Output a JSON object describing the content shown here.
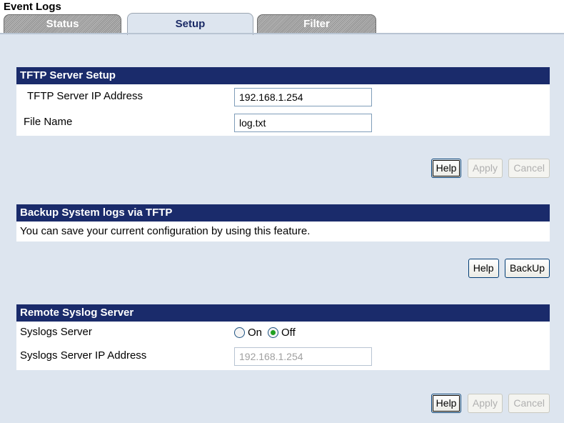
{
  "page": {
    "title": "Event Logs"
  },
  "tabs": [
    {
      "label": "Status",
      "active": false
    },
    {
      "label": "Setup",
      "active": true
    },
    {
      "label": "Filter",
      "active": false
    }
  ],
  "tftp": {
    "header": "TFTP Server Setup",
    "ip_label": "TFTP Server IP Address",
    "ip_value": "192.168.1.254",
    "file_label": "File Name",
    "file_value": "log.txt",
    "buttons": {
      "help": "Help",
      "apply": "Apply",
      "cancel": "Cancel"
    }
  },
  "backup": {
    "header": "Backup System logs via TFTP",
    "description": "You can save your current configuration by using this feature.",
    "buttons": {
      "help": "Help",
      "backup": "BackUp"
    }
  },
  "syslog": {
    "header": "Remote Syslog Server",
    "server_label": "Syslogs Server",
    "options": {
      "on": "On",
      "off": "Off"
    },
    "selected": "Off",
    "ip_label": "Syslogs Server IP Address",
    "ip_value": "192.168.1.254",
    "buttons": {
      "help": "Help",
      "apply": "Apply",
      "cancel": "Cancel"
    }
  },
  "colors": {
    "header_bg": "#1a2b6b",
    "page_bg": "#dde5ef",
    "radio_checked": "#21a121"
  }
}
